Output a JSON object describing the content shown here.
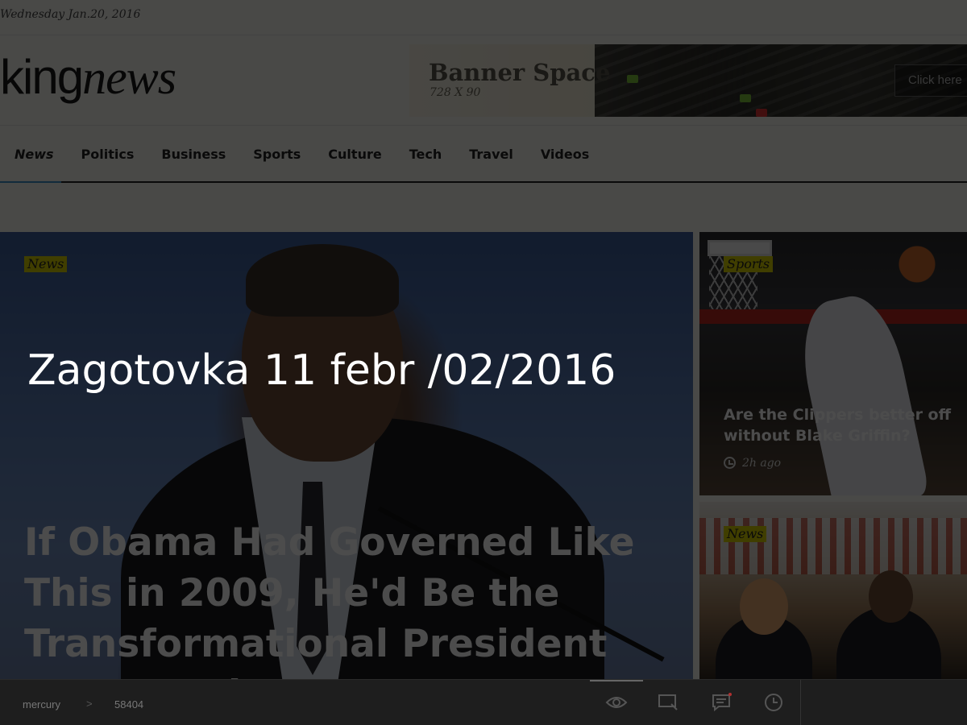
{
  "header": {
    "date": "Wednesday Jan.20, 2016"
  },
  "logo": {
    "part1": "king",
    "part2": "news"
  },
  "banner": {
    "title": "Banner Space",
    "size": "728 X 90",
    "button": "Click here"
  },
  "nav": {
    "items": [
      {
        "label": "News",
        "active": true
      },
      {
        "label": "Politics"
      },
      {
        "label": "Business"
      },
      {
        "label": "Sports"
      },
      {
        "label": "Culture"
      },
      {
        "label": "Tech"
      },
      {
        "label": "Travel"
      },
      {
        "label": "Videos"
      }
    ],
    "accent_color": "#3d8fc9"
  },
  "featured": {
    "category": "News",
    "headline": "If Obama Had Governed Like This in 2009, He'd Be the Transformational President We Hoped F"
  },
  "side_cards": [
    {
      "category": "Sports",
      "title": "Are the Clippers better off without Blake Griffin?",
      "time": "2h ago"
    },
    {
      "category": "News"
    }
  ],
  "overlay": {
    "caption": "Zagotovka 11 febr /02/2016"
  },
  "bottombar": {
    "breadcrumb": "mercury",
    "separator": ">",
    "value": "58404",
    "tools": [
      "eye-icon",
      "select-region-icon",
      "comment-icon",
      "clock-icon"
    ]
  },
  "colors": {
    "category_label": "#d8d000",
    "overlay": "rgba(0,0,0,0.70)"
  }
}
